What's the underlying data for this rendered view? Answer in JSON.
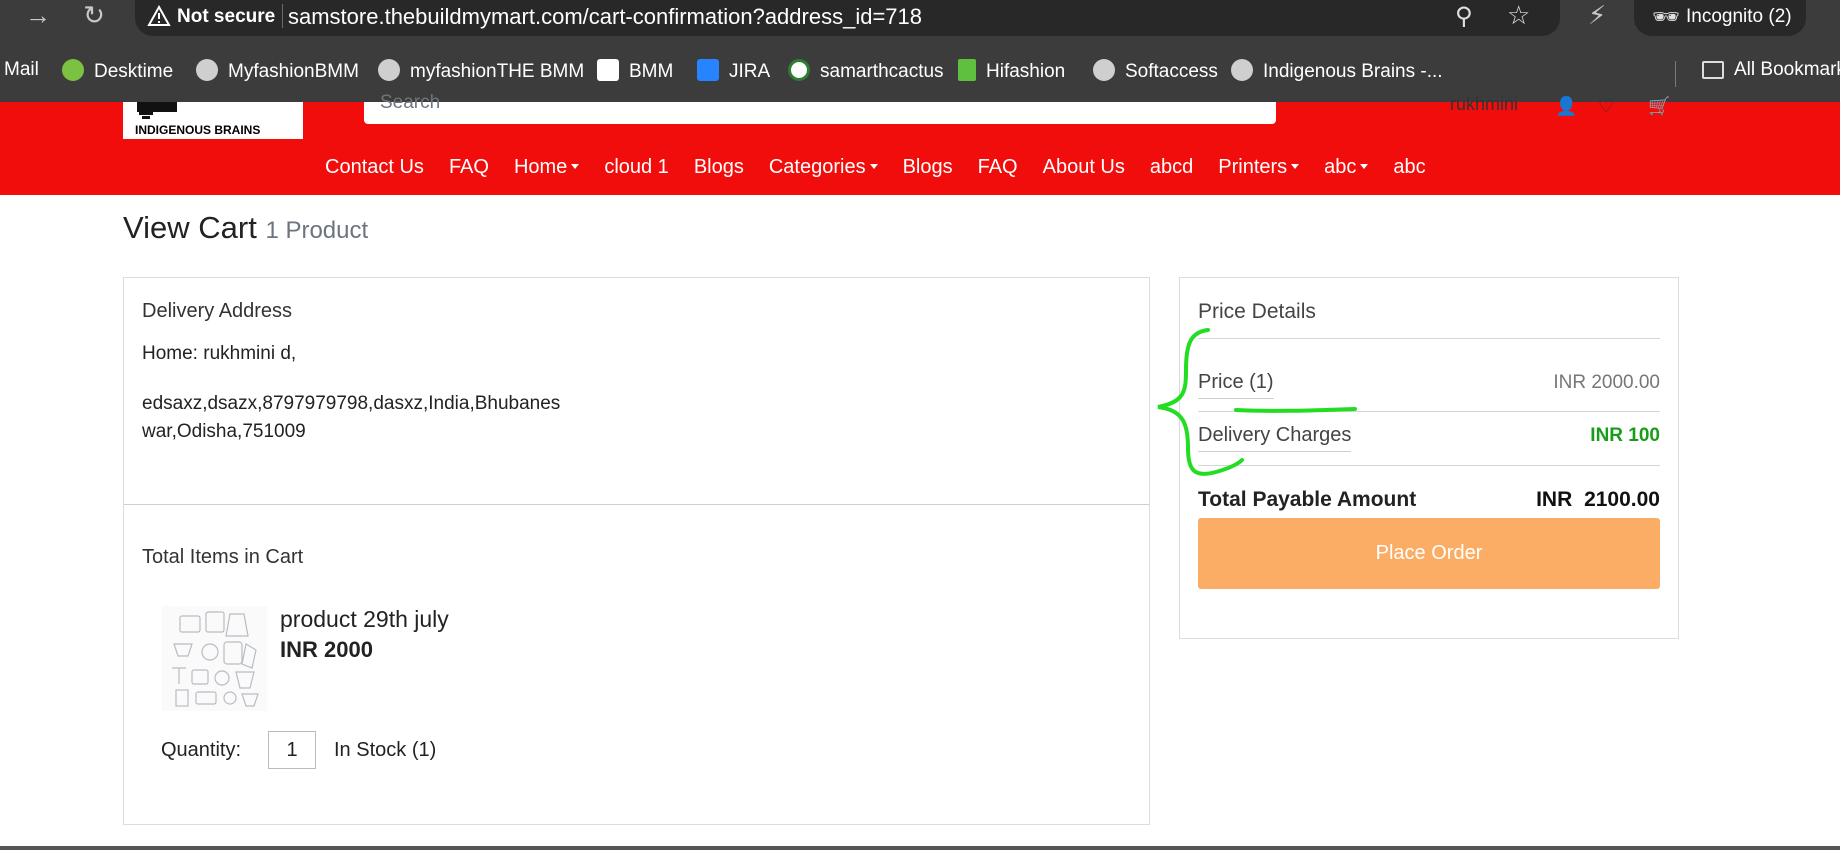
{
  "browser": {
    "back_icon": "arrow-right-icon",
    "security_label": "Not secure",
    "url": "samstore.thebuildmymart.com/cart-confirmation?address_id=718",
    "incognito_label": "Incognito (2)"
  },
  "bookmarks": [
    {
      "label": "Mail",
      "color": "#ffffff"
    },
    {
      "label": "Desktime",
      "color": "#7cc242"
    },
    {
      "label": "MyfashionBMM",
      "color": "#cfcfcf"
    },
    {
      "label": "myfashionTHE BMM",
      "color": "#cfcfcf"
    },
    {
      "label": "BMM",
      "color": "#9b59b6"
    },
    {
      "label": "JIRA",
      "color": "#2684ff"
    },
    {
      "label": "samarthcactus",
      "color": "#2e7d32"
    },
    {
      "label": "Hifashion",
      "color": "#5fbf3f"
    },
    {
      "label": "Softaccess",
      "color": "#cfcfcf"
    },
    {
      "label": "Indigenous Brains -...",
      "color": "#cfcfcf"
    }
  ],
  "all_bookmarks_label": "All Bookmarks",
  "header": {
    "logo_text": "INDIGENOUS BRAINS",
    "search_placeholder": "Search",
    "user_name": "rukhmini"
  },
  "nav": [
    {
      "label": "Contact Us",
      "dropdown": false
    },
    {
      "label": "FAQ",
      "dropdown": false
    },
    {
      "label": "Home",
      "dropdown": true
    },
    {
      "label": "cloud 1",
      "dropdown": false
    },
    {
      "label": "Blogs",
      "dropdown": false
    },
    {
      "label": "Categories",
      "dropdown": true
    },
    {
      "label": "Blogs",
      "dropdown": false
    },
    {
      "label": "FAQ",
      "dropdown": false
    },
    {
      "label": "About Us",
      "dropdown": false
    },
    {
      "label": "abcd",
      "dropdown": false
    },
    {
      "label": "Printers",
      "dropdown": true
    },
    {
      "label": "abc",
      "dropdown": true
    },
    {
      "label": "abc",
      "dropdown": false
    }
  ],
  "page": {
    "title": "View Cart",
    "count": "1 Product"
  },
  "delivery": {
    "title": "Delivery Address",
    "name_line": "Home: rukhmini d,",
    "address_line1": "edsaxz,dsazx,8797979798,dasxz,India,Bhubanes",
    "address_line2": "war,Odisha,751009"
  },
  "cart": {
    "title": "Total Items in Cart",
    "product_name": "product 29th july",
    "product_price": "INR 2000",
    "quantity_label": "Quantity:",
    "quantity_value": "1",
    "stock_text": "In Stock (1)"
  },
  "price_details": {
    "title": "Price Details",
    "price_label": "Price  (1)",
    "price_value": "INR 2000.00",
    "delivery_label": "Delivery Charges",
    "delivery_value": "INR 100",
    "total_label": "Total Payable Amount",
    "total_value": "INR  2100.00",
    "place_order_label": "Place Order"
  },
  "colors": {
    "brand_red": "#f20d0d",
    "place_order": "#fcad65",
    "delivery_green": "#1a9c1a",
    "annotation_green": "#22dd22"
  }
}
